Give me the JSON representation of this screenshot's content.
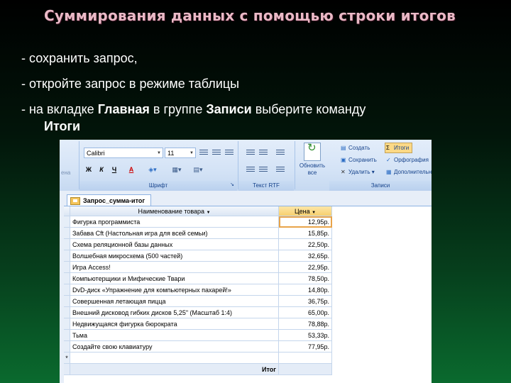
{
  "slide": {
    "title": "Суммирования данных с помощью строки итогов",
    "bullet1": "- сохранить запрос,",
    "bullet2": "- откройте запрос в режиме таблицы",
    "bullet3_prefix": "- на вкладке ",
    "bullet3_bold1": "Главная",
    "bullet3_mid": "  в группе ",
    "bullet3_bold2": "Записи",
    "bullet3_suffix": " выберите команду",
    "bullet3_bold3": "Итоги"
  },
  "ribbon": {
    "font_name": "Calibri",
    "font_size": "11",
    "bold": "Ж",
    "italic": "К",
    "underline": "Ч",
    "font_group_label": "Шрифт",
    "rtf_group_label": "Текст RTF",
    "refresh_label": "Обновить все",
    "records_group_label": "Записи",
    "records": {
      "create": "Создать",
      "save": "Сохранить",
      "delete": "Удалить",
      "totals": "Итоги",
      "spelling": "Орфография",
      "more": "Дополнительно"
    },
    "left_fragment": "ена"
  },
  "datasheet": {
    "tab_title": "Запрос_сумма-итог",
    "col_name": "Наименование товара",
    "col_price": "Цена",
    "rows": [
      {
        "name": "Фигурка программиста",
        "price": "12,95р."
      },
      {
        "name": "Забава Cft (Настольная игра для всей семьи)",
        "price": "15,85р."
      },
      {
        "name": "Схема реляционной базы данных",
        "price": "22,50р."
      },
      {
        "name": "Волшебная микросхема (500 частей)",
        "price": "32,65р."
      },
      {
        "name": "Игра Access!",
        "price": "22,95р."
      },
      {
        "name": "Компьютерщики и Мифические Твари",
        "price": "78,50р."
      },
      {
        "name": "DvD-диск «Упражнение для компьютерных пахарей!»",
        "price": "14,80р."
      },
      {
        "name": "Совершенная летающая пицца",
        "price": "36,75р."
      },
      {
        "name": "Внешний дисковод гибких дисков 5,25\" (Масштаб 1:4)",
        "price": "65,00р."
      },
      {
        "name": "Недвижущаяся фигурка бюрократа",
        "price": "78,88р."
      },
      {
        "name": "Тьма",
        "price": "53,33р."
      },
      {
        "name": "Создайте свою клавиатуру",
        "price": "77,95р."
      }
    ],
    "new_row_marker": "*",
    "total_label": "Итог"
  }
}
